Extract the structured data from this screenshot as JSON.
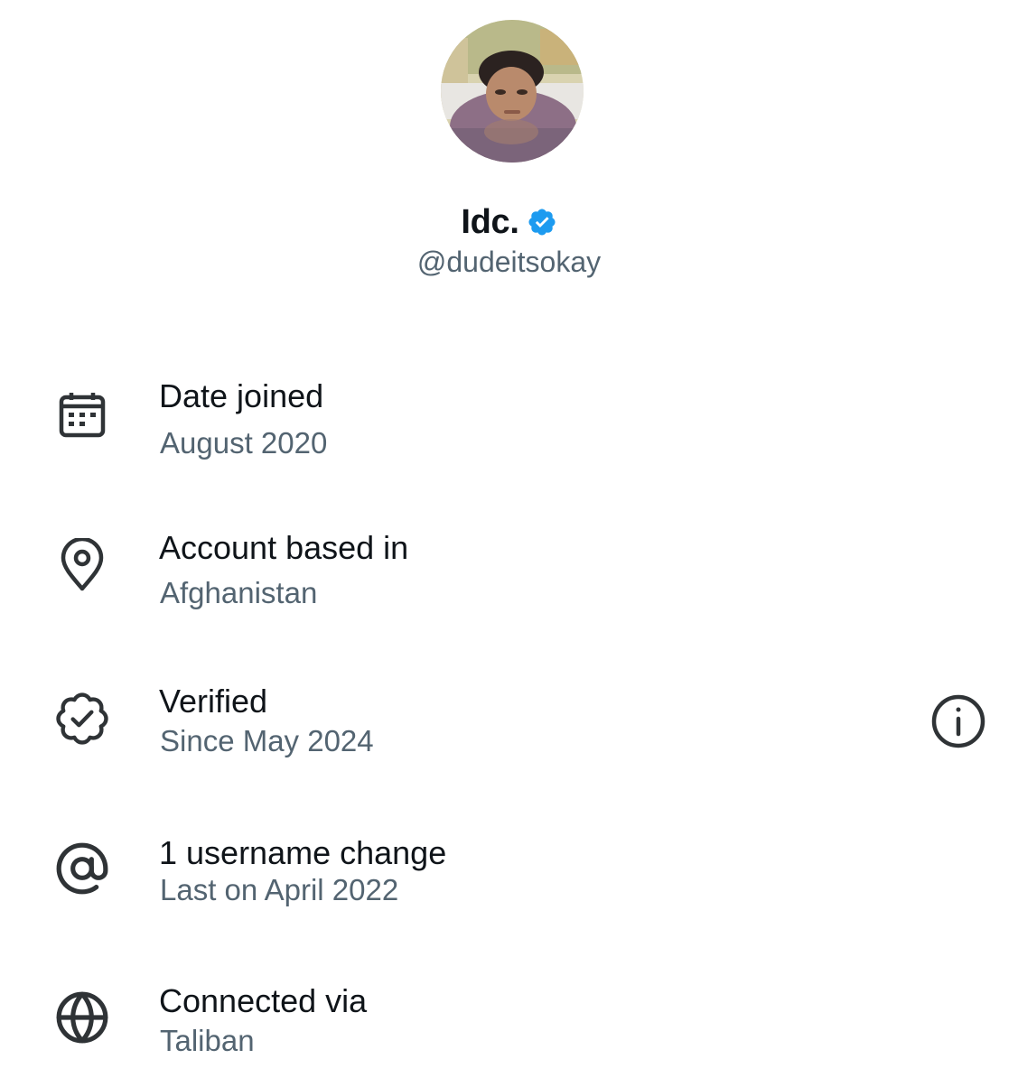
{
  "profile": {
    "display_name": "Idc.",
    "handle": "@dudeitsokay",
    "verified": true,
    "badge_color": "#1d9bf0"
  },
  "details": [
    {
      "icon": "calendar-icon",
      "label": "Date joined",
      "value": "August 2020"
    },
    {
      "icon": "location-pin-icon",
      "label": "Account based in",
      "value": "Afghanistan"
    },
    {
      "icon": "verified-badge-outline-icon",
      "label": "Verified",
      "value": "Since May 2024"
    },
    {
      "icon": "at-sign-icon",
      "label": "1 username change",
      "value": "Last on April 2022"
    },
    {
      "icon": "globe-icon",
      "label": "Connected via",
      "value": "Taliban"
    }
  ],
  "info_icon": "info-icon",
  "colors": {
    "primary_text": "#0f1419",
    "secondary_text": "#536471",
    "icon": "#2f3336"
  }
}
